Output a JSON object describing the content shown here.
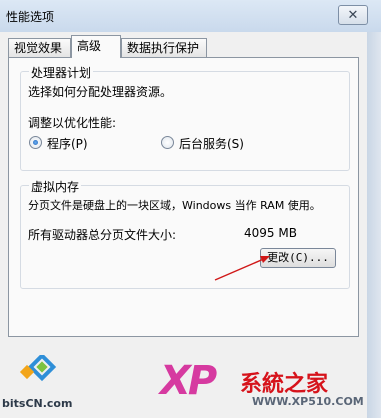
{
  "window": {
    "title": "性能选项",
    "close_glyph": "✕"
  },
  "tabs": [
    {
      "label": "视觉效果",
      "active": false
    },
    {
      "label": "高级",
      "active": true
    },
    {
      "label": "数据执行保护",
      "active": false
    }
  ],
  "processor": {
    "title": "处理器计划",
    "description": "选择如何分配处理器资源。",
    "adjust_label": "调整以优化性能:",
    "options": [
      {
        "label": "程序(P)",
        "selected": true
      },
      {
        "label": "后台服务(S)",
        "selected": false
      }
    ]
  },
  "virtual_memory": {
    "title": "虚拟内存",
    "description": "分页文件是硬盘上的一块区域，Windows 当作 RAM 使用。",
    "total_label": "所有驱动器总分页文件大小:",
    "total_value": "4095 MB",
    "change_button": "更改(C)..."
  },
  "annotation": {
    "arrow_color": "#d01818"
  },
  "watermarks": {
    "left_site": "bitsCN.com",
    "xp_logo": "XP",
    "brand": "系統之家",
    "url": "WWW.XP510.COM"
  }
}
